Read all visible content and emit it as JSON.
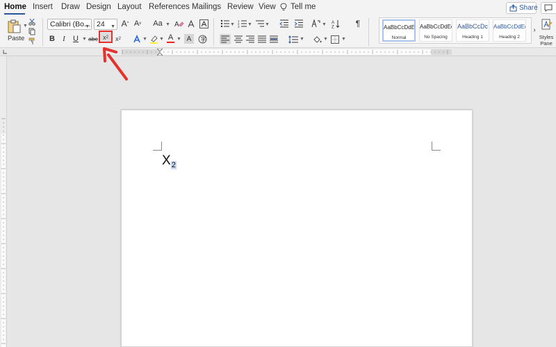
{
  "tabs": [
    "Home",
    "Insert",
    "Draw",
    "Design",
    "Layout",
    "References",
    "Mailings",
    "Review",
    "View",
    "Tell me"
  ],
  "share_label": "Share",
  "paste_label": "Paste",
  "font_name": "Calibri (Bo...",
  "font_size": "24",
  "format_labels": {
    "bold": "B",
    "italic": "I",
    "underline": "U",
    "strikethrough": "abc",
    "subscript": "x",
    "superscript": "x",
    "change_case": "Aa",
    "grow_font": "A",
    "shrink_font": "A",
    "font_color": "A",
    "shading": "A",
    "pilcrow": "¶",
    "sort": "A↓"
  },
  "styles": [
    {
      "sample": "AaBbCcDdEe",
      "name": "Normal",
      "selected": true
    },
    {
      "sample": "AaBbCcDdEe",
      "name": "No Spacing",
      "selected": false
    },
    {
      "sample": "AaBbCcDc",
      "name": "Heading 1",
      "selected": false
    },
    {
      "sample": "AaBbCcDdEe",
      "name": "Heading 2",
      "selected": false
    }
  ],
  "styles_pane_label": [
    "Styles",
    "Pane"
  ],
  "document": {
    "main_char": "X",
    "subscript_char": "2"
  },
  "colors": {
    "accent": "#2b579a",
    "annotation": "#e4312b",
    "selection": "#c9d9f1",
    "heading": "#2f5597"
  },
  "icons": [
    "lightbulb-icon",
    "share-icon",
    "comment-icon",
    "paste-icon",
    "cut-icon",
    "copy-icon",
    "format-painter-icon",
    "clear-formatting-icon",
    "bullets-icon",
    "numbering-icon",
    "multilevel-list-icon",
    "decrease-indent-icon",
    "increase-indent-icon",
    "align-left-icon",
    "center-icon",
    "align-right-icon",
    "justify-icon",
    "line-spacing-icon",
    "fill-icon",
    "borders-icon",
    "text-effects-icon",
    "highlight-icon",
    "annotation-arrow-icon"
  ]
}
